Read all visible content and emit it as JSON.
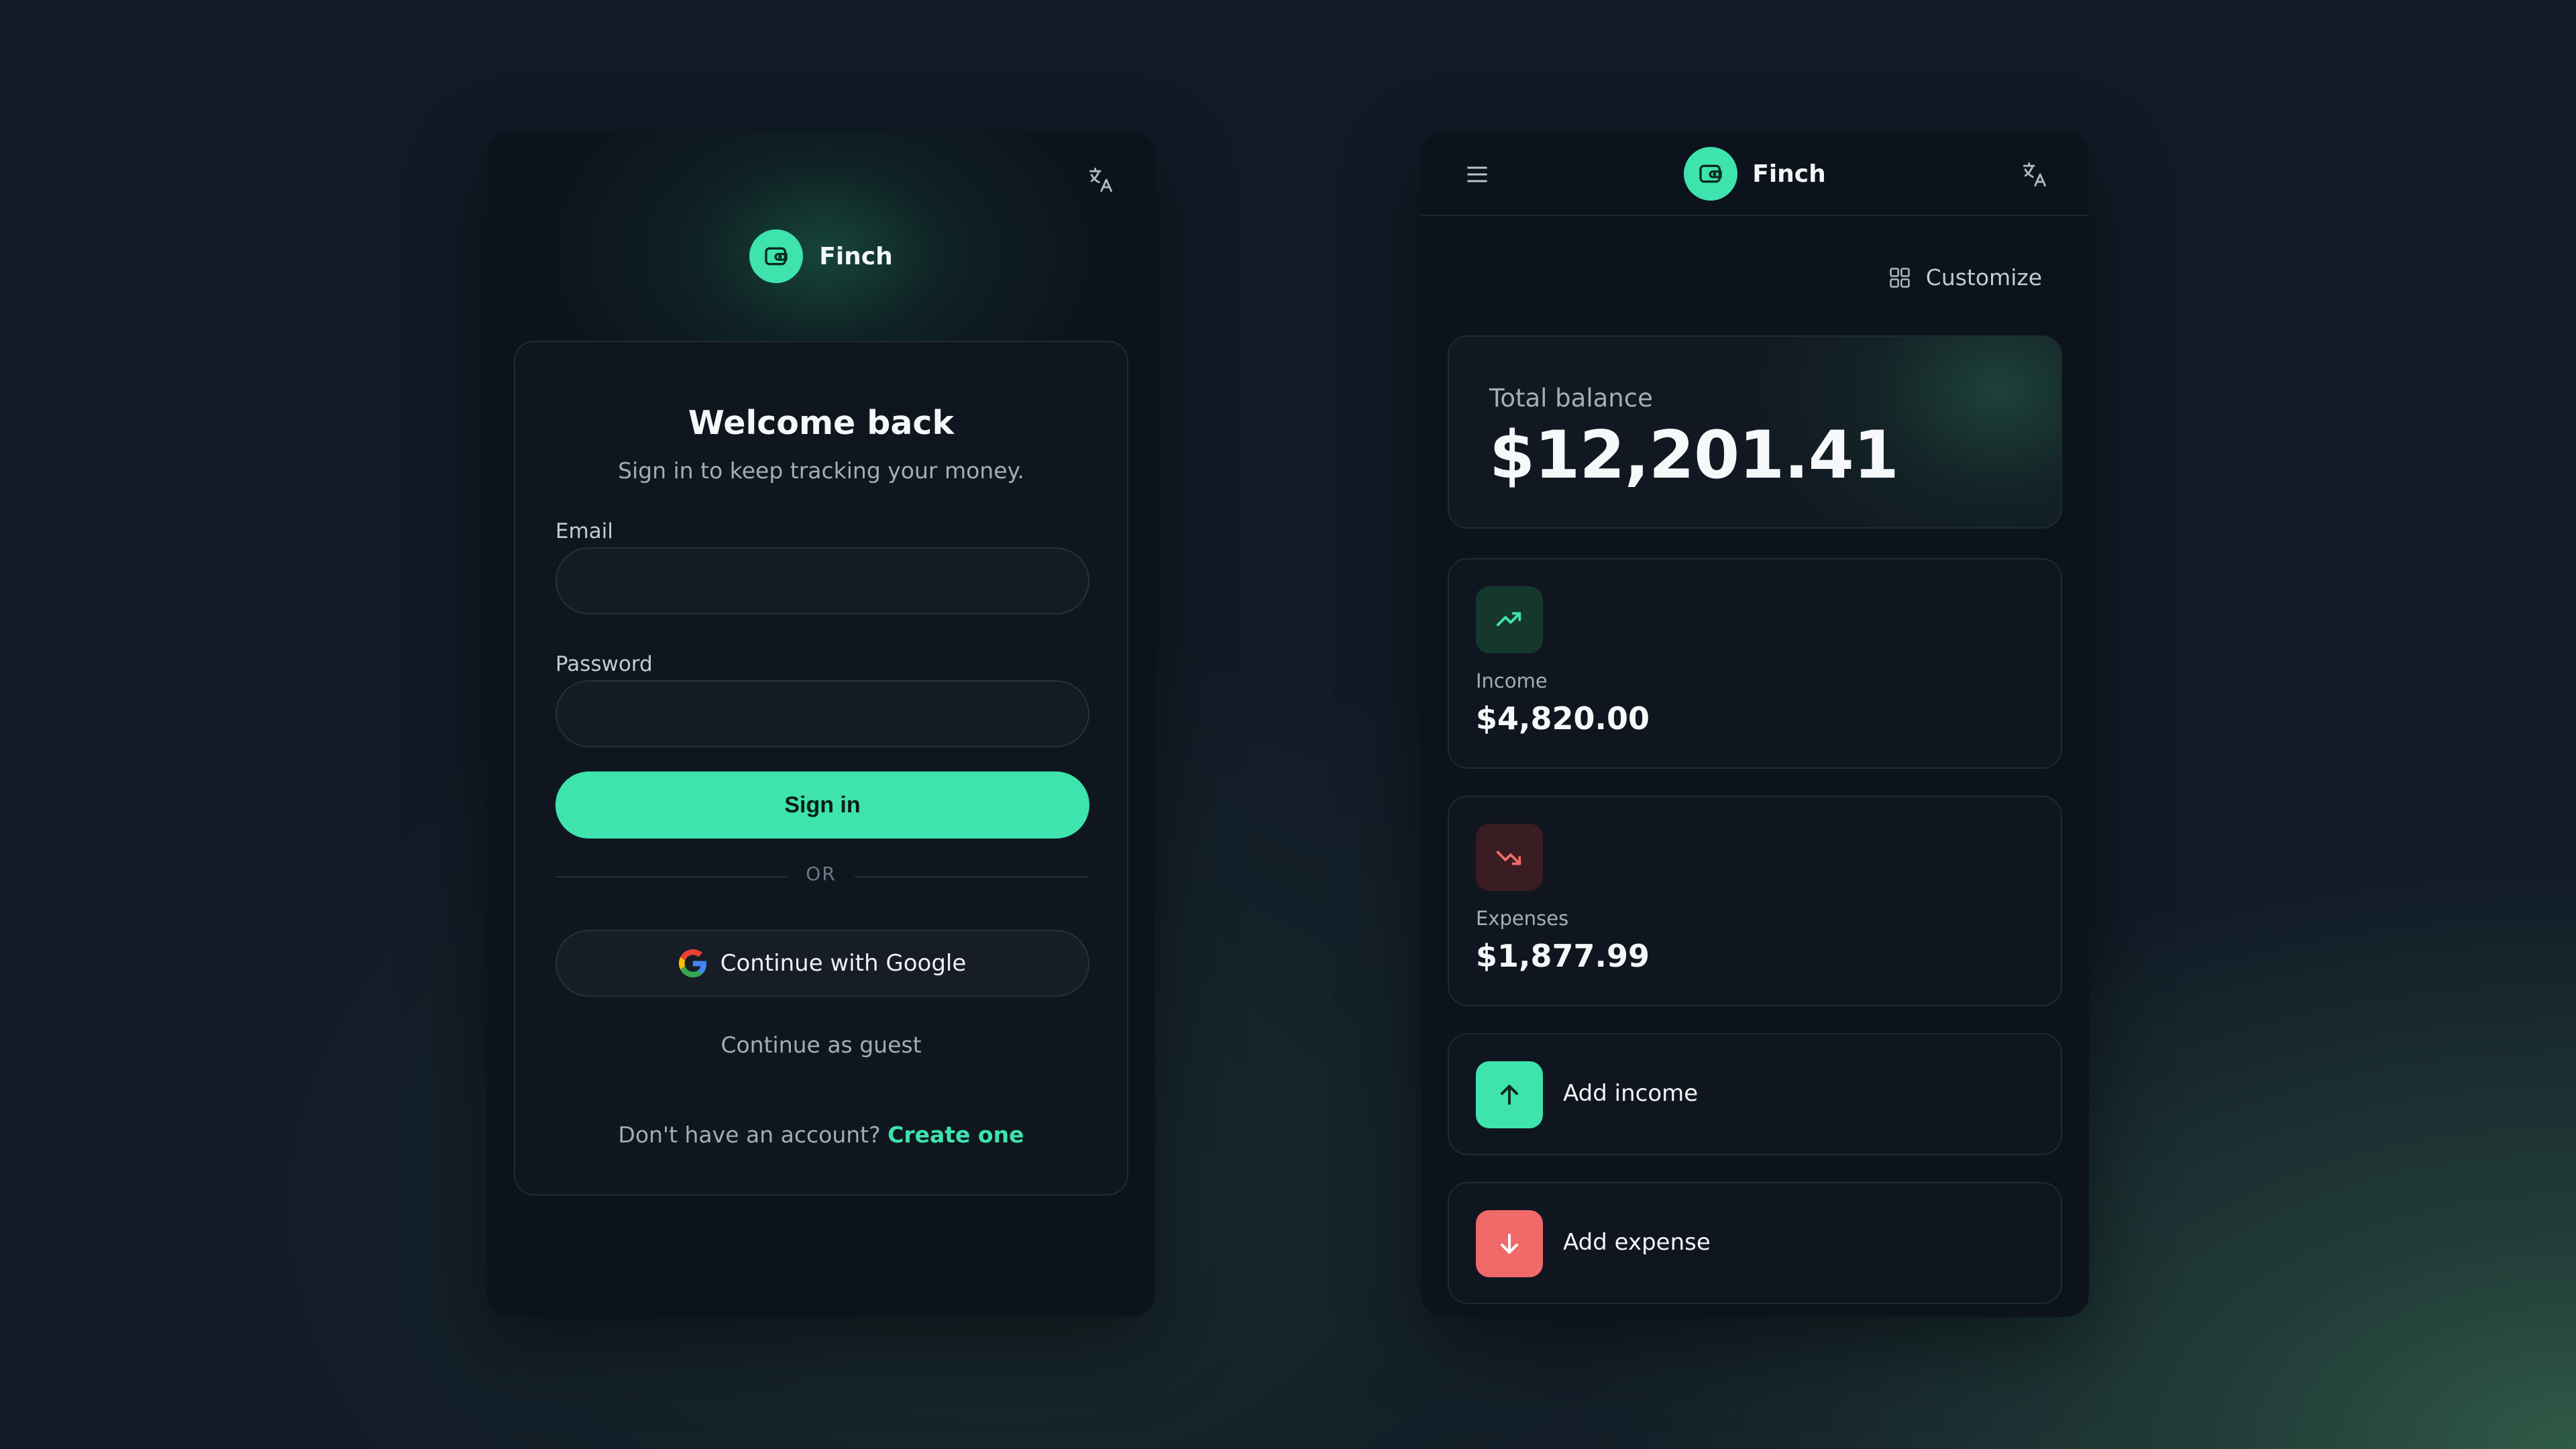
{
  "colors": {
    "accent": "#3ee3ad",
    "danger": "#f06a6a",
    "panel": "#0d131c",
    "card": "#10161f"
  },
  "login": {
    "brand": "Finch",
    "title": "Welcome back",
    "subtitle": "Sign in to keep tracking your money.",
    "email_label": "Email",
    "email_value": "",
    "password_label": "Password",
    "password_value": "",
    "signin_label": "Sign in",
    "or_label": "OR",
    "google_label": "Continue with Google",
    "guest_label": "Continue as guest",
    "no_account_text": "Don't have an account?",
    "create_label": "Create one",
    "icons": {
      "translate": "translate-icon",
      "logo": "wallet-icon",
      "google": "google-icon"
    }
  },
  "dashboard": {
    "brand": "Finch",
    "customize_label": "Customize",
    "balance_label": "Total balance",
    "balance_value": "$12,201.41",
    "income": {
      "label": "Income",
      "value": "$4,820.00",
      "icon": "trending-up-icon"
    },
    "expenses": {
      "label": "Expenses",
      "value": "$1,877.99",
      "icon": "trending-down-icon"
    },
    "add_income_label": "Add income",
    "add_expense_label": "Add expense",
    "icons": {
      "menu": "menu-icon",
      "translate": "translate-icon",
      "customize": "grid-icon",
      "logo": "wallet-icon"
    }
  }
}
